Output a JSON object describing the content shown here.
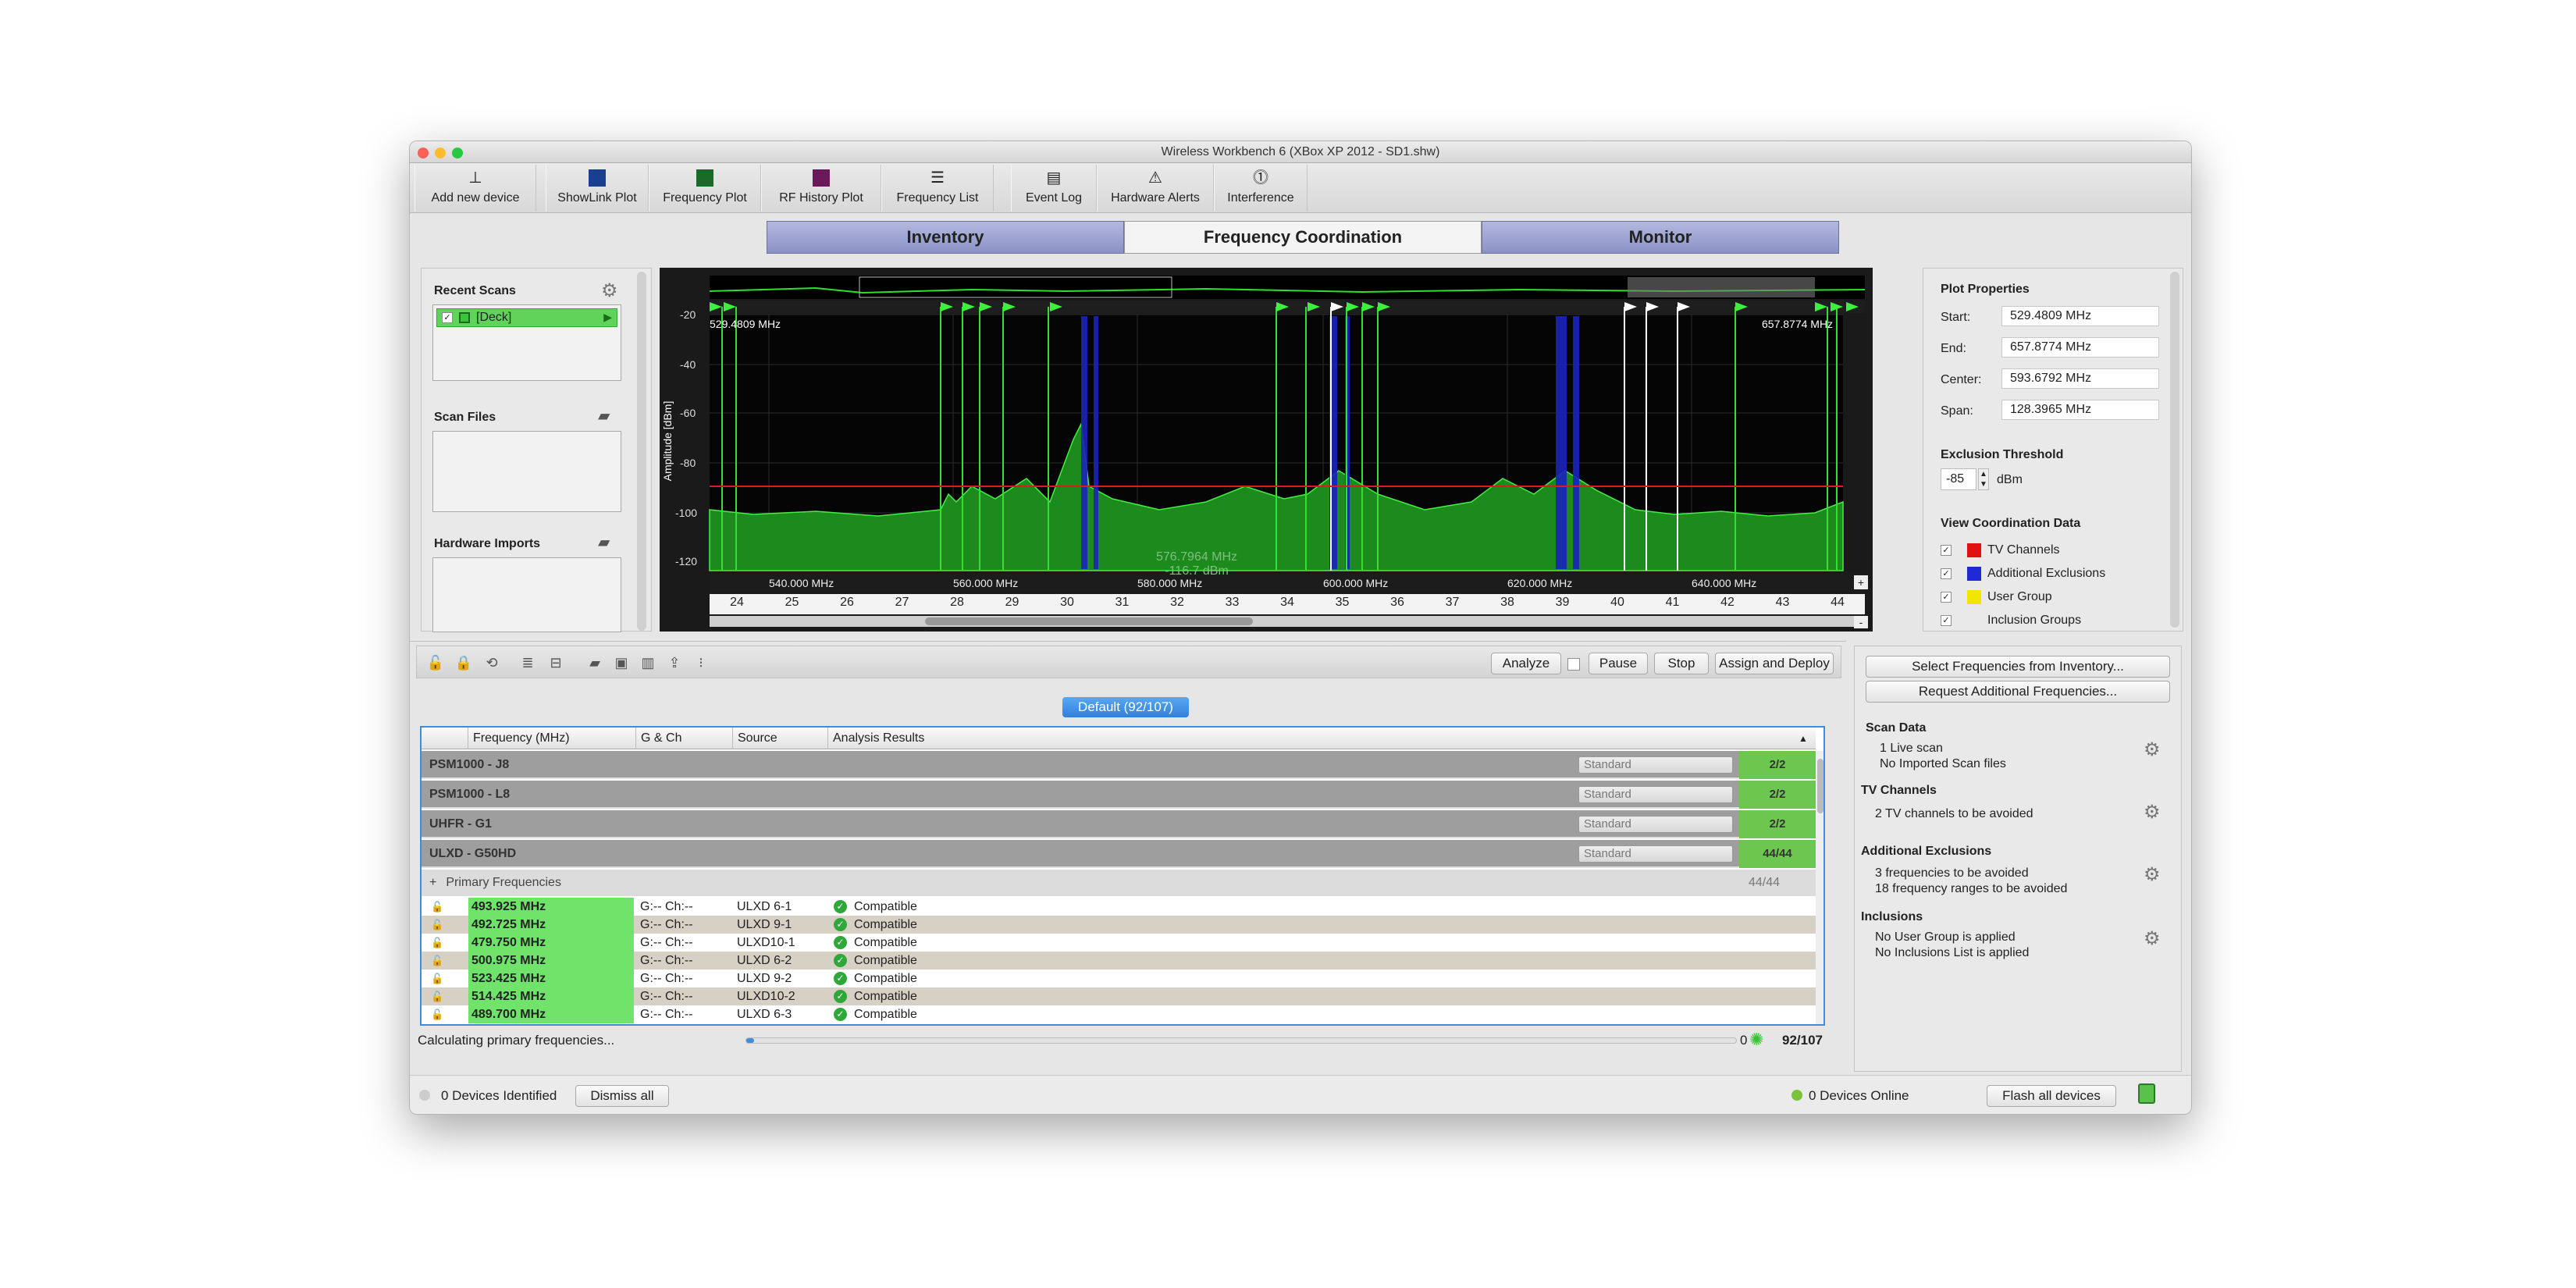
{
  "window": {
    "title": "Wireless Workbench 6 (XBox XP 2012 - SD1.shw)"
  },
  "toolbar": {
    "add_device": "Add new device",
    "showlink_plot": "ShowLink Plot",
    "frequency_plot": "Frequency Plot",
    "rf_history_plot": "RF History Plot",
    "frequency_list": "Frequency List",
    "event_log": "Event Log",
    "hardware_alerts": "Hardware Alerts",
    "interference": "Interference"
  },
  "tabs": {
    "inventory": "Inventory",
    "frequency_coordination": "Frequency Coordination",
    "monitor": "Monitor"
  },
  "left": {
    "recent_scans": "Recent Scans",
    "deck_item": "[Deck]",
    "scan_files": "Scan Files",
    "hardware_imports": "Hardware Imports"
  },
  "plot": {
    "start_marker": "529.4809 MHz",
    "end_marker": "657.8774 MHz",
    "y_axis_label": "Amplitude [dBm]",
    "y_ticks": [
      "-20",
      "-40",
      "-60",
      "-80",
      "-100",
      "-120"
    ],
    "x_ticks": [
      "540.000 MHz",
      "560.000 MHz",
      "580.000 MHz",
      "600.000 MHz",
      "620.000 MHz",
      "640.000 MHz"
    ],
    "cursor_freq": "576.7964 MHz",
    "cursor_amp": "-116.7 dBm",
    "channels": [
      "24",
      "25",
      "26",
      "27",
      "28",
      "29",
      "30",
      "31",
      "32",
      "33",
      "34",
      "35",
      "36",
      "37",
      "38",
      "39",
      "40",
      "41",
      "42",
      "43",
      "44"
    ],
    "zoom_plus": "+",
    "zoom_minus": "-"
  },
  "plot_properties": {
    "title": "Plot Properties",
    "start_label": "Start:",
    "start": "529.4809 MHz",
    "end_label": "End:",
    "end": "657.8774 MHz",
    "center_label": "Center:",
    "center": "593.6792 MHz",
    "span_label": "Span:",
    "span": "128.3965 MHz",
    "exclusion_title": "Exclusion Threshold",
    "threshold": "-85",
    "threshold_unit": "dBm",
    "view_title": "View Coordination Data",
    "legend": [
      {
        "label": "TV Channels",
        "color": "#e01010"
      },
      {
        "label": "Additional Exclusions",
        "color": "#1f2ad6"
      },
      {
        "label": "User Group",
        "color": "#f2e600"
      },
      {
        "label": "Inclusion Groups",
        "color": ""
      }
    ]
  },
  "list_toolbar": {
    "analyze": "Analyze",
    "pause": "Pause",
    "stop": "Stop",
    "assign_deploy": "Assign and Deploy"
  },
  "default_tab": "Default (92/107)",
  "table": {
    "headers": [
      "Frequency (MHz)",
      "G & Ch",
      "Source",
      "Analysis Results"
    ],
    "groups": [
      {
        "name": "PSM1000 - J8",
        "mode": "Standard",
        "count": "2/2"
      },
      {
        "name": "PSM1000 - L8",
        "mode": "Standard",
        "count": "2/2"
      },
      {
        "name": "UHFR - G1",
        "mode": "Standard",
        "count": "2/2"
      },
      {
        "name": "ULXD - G50HD",
        "mode": "Standard",
        "count": "44/44"
      }
    ],
    "primary": {
      "label": "Primary Frequencies",
      "count": "44/44"
    },
    "rows": [
      {
        "freq": "493.925 MHz",
        "gch": "G:-- Ch:--",
        "source": "ULXD 6-1",
        "result": "Compatible"
      },
      {
        "freq": "492.725 MHz",
        "gch": "G:-- Ch:--",
        "source": "ULXD 9-1",
        "result": "Compatible"
      },
      {
        "freq": "479.750 MHz",
        "gch": "G:-- Ch:--",
        "source": "ULXD10-1",
        "result": "Compatible"
      },
      {
        "freq": "500.975 MHz",
        "gch": "G:-- Ch:--",
        "source": "ULXD 6-2",
        "result": "Compatible"
      },
      {
        "freq": "523.425 MHz",
        "gch": "G:-- Ch:--",
        "source": "ULXD 9-2",
        "result": "Compatible"
      },
      {
        "freq": "514.425 MHz",
        "gch": "G:-- Ch:--",
        "source": "ULXD10-2",
        "result": "Compatible"
      },
      {
        "freq": "489.700 MHz",
        "gch": "G:-- Ch:--",
        "source": "ULXD 6-3",
        "result": "Compatible"
      }
    ]
  },
  "progress": {
    "text": "Calculating primary frequencies...",
    "zero": "0",
    "count": "92/107",
    "fraction": 0.008
  },
  "right": {
    "select_inventory": "Select Frequencies from Inventory...",
    "request_additional": "Request Additional Frequencies...",
    "scan_title": "Scan Data",
    "scan_1": "1 Live scan",
    "scan_2": "No Imported Scan files",
    "tv_title": "TV Channels",
    "tv_1": "2 TV channels to be avoided",
    "ae_title": "Additional Exclusions",
    "ae_1": "3 frequencies to be avoided",
    "ae_2": "18 frequency ranges to be avoided",
    "inc_title": "Inclusions",
    "inc_1": "No User Group is applied",
    "inc_2": "No Inclusions List is applied"
  },
  "status": {
    "devices_identified": "0 Devices Identified",
    "dismiss": "Dismiss all",
    "devices_online": "0 Devices Online",
    "flash": "Flash all devices"
  }
}
